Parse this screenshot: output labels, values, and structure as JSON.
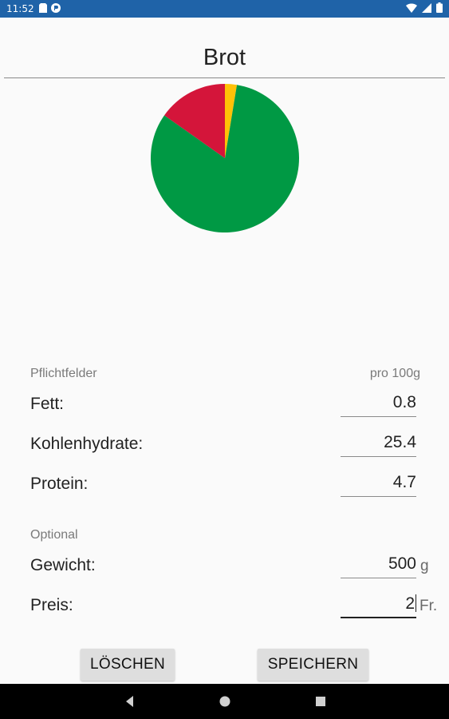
{
  "status_bar": {
    "time": "11:52",
    "icons": [
      "sd-card-icon",
      "notification-icon"
    ],
    "right_icons": [
      "wifi-icon",
      "signal-icon",
      "battery-icon"
    ],
    "background": "#1f63a8"
  },
  "header": {
    "title": "Brot"
  },
  "chart_data": {
    "type": "pie",
    "title": "",
    "series": [
      {
        "values": [
          0.8,
          25.4,
          4.7
        ],
        "colors": [
          "#ffc107",
          "#009944",
          "#d4153a"
        ]
      }
    ]
  },
  "required": {
    "section_label": "Pflichtfelder",
    "unit_label": "pro 100g",
    "fields": [
      {
        "label": "Fett:",
        "value": "0.8"
      },
      {
        "label": "Kohlenhydrate:",
        "value": "25.4"
      },
      {
        "label": "Protein:",
        "value": "4.7"
      }
    ]
  },
  "optional": {
    "section_label": "Optional",
    "fields": [
      {
        "label": "Gewicht:",
        "value": "500",
        "suffix": "g"
      },
      {
        "label": "Preis:",
        "value": "2",
        "suffix": "Fr."
      }
    ]
  },
  "buttons": {
    "delete": "LÖSCHEN",
    "save": "SPEICHERN"
  },
  "nav": {
    "icons": [
      "back-icon",
      "home-icon",
      "recents-icon"
    ]
  }
}
